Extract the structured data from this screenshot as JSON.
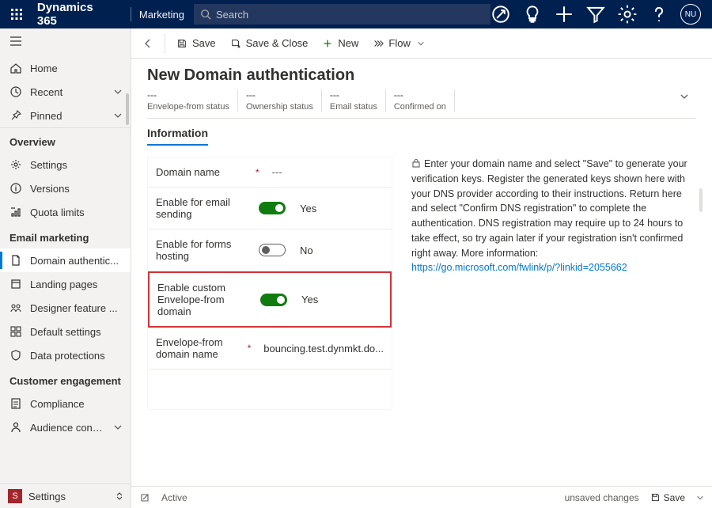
{
  "top": {
    "brand": "Dynamics 365",
    "app": "Marketing",
    "search_placeholder": "Search",
    "avatar": "NU"
  },
  "sidebar": {
    "home": "Home",
    "recent": "Recent",
    "pinned": "Pinned",
    "sections": [
      {
        "title": "Overview",
        "items": [
          "Settings",
          "Versions",
          "Quota limits"
        ]
      },
      {
        "title": "Email marketing",
        "items": [
          "Domain authentic...",
          "Landing pages",
          "Designer feature ...",
          "Default settings",
          "Data protections"
        ]
      },
      {
        "title": "Customer engagement",
        "items": [
          "Compliance",
          "Audience configur..."
        ]
      }
    ],
    "area_label": "Settings",
    "area_badge": "S"
  },
  "command": {
    "save": "Save",
    "save_close": "Save & Close",
    "new": "New",
    "flow": "Flow"
  },
  "page": {
    "title": "New Domain authentication",
    "status": [
      {
        "val": "---",
        "lbl": "Envelope-from status"
      },
      {
        "val": "---",
        "lbl": "Ownership status"
      },
      {
        "val": "---",
        "lbl": "Email status"
      },
      {
        "val": "---",
        "lbl": "Confirmed on"
      }
    ],
    "tab": "Information",
    "form": {
      "domain_name_label": "Domain name",
      "domain_name_value": "---",
      "enable_email_label": "Enable for email sending",
      "enable_email_toggle": "Yes",
      "enable_forms_label": "Enable for forms hosting",
      "enable_forms_toggle": "No",
      "enable_custom_label": "Enable custom Envelope-from domain",
      "enable_custom_toggle": "Yes",
      "envelope_domain_label": "Envelope-from domain name",
      "envelope_domain_value": "bouncing.test.dynmkt.do..."
    },
    "info_text": "Enter your domain name and select \"Save\" to generate your verification keys. Register the generated keys shown here with your DNS provider according to their instructions. Return here and select \"Confirm DNS registration\" to complete the authentication. DNS registration may require up to 24 hours to take effect, so try again later if your registration isn't confirmed right away. More information:",
    "info_link": "https://go.microsoft.com/fwlink/p/?linkid=2055662"
  },
  "footer": {
    "state": "Active",
    "unsaved": "unsaved changes",
    "save": "Save"
  }
}
